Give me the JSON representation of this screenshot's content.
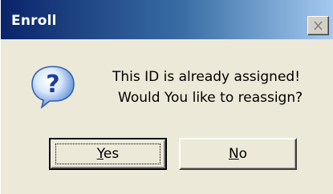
{
  "window": {
    "title": "Enroll",
    "close_icon": "close-icon"
  },
  "message": {
    "icon": "question-icon",
    "line1": "This ID is already assigned!",
    "line2": "Would You like to reassign?"
  },
  "buttons": {
    "yes": {
      "label": "Yes",
      "accesskey": "Y",
      "rest": "es"
    },
    "no": {
      "label": "No",
      "accesskey": "N",
      "rest": "o"
    }
  },
  "colors": {
    "title_start": "#0a246a",
    "title_end": "#a6caf0",
    "face": "#ece9d8"
  }
}
